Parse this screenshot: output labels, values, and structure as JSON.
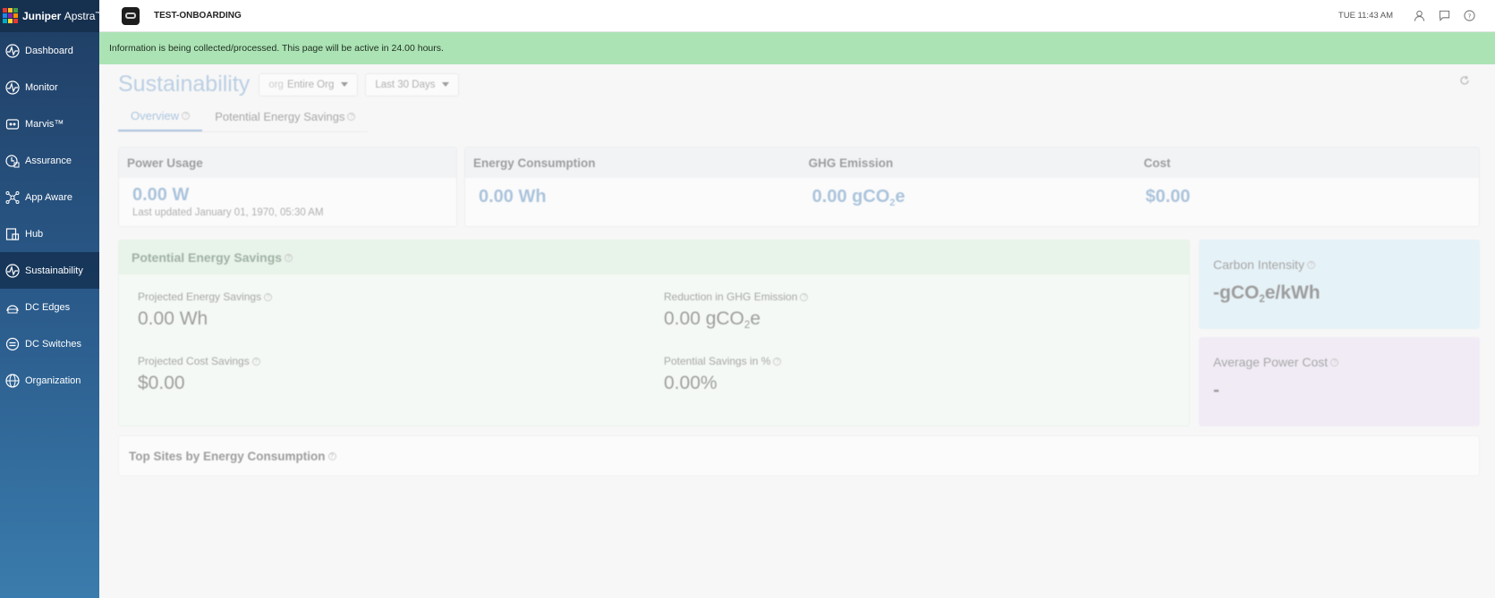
{
  "brand": {
    "name_bold": "Juniper",
    "name_light": "Apstra",
    "trademark": "™",
    "logo_colors": [
      "#e53935",
      "#fbc02d",
      "#43a047",
      "#1e88e5",
      "#8e24aa",
      "#fb8c00",
      "#00acc1",
      "#fdd835",
      "#e53935"
    ]
  },
  "sidebar": {
    "items": [
      {
        "label": "Dashboard",
        "icon": "pulse-icon"
      },
      {
        "label": "Monitor",
        "icon": "pulse-icon"
      },
      {
        "label": "Marvis™",
        "icon": "marvis-icon"
      },
      {
        "label": "Assurance",
        "icon": "assurance-icon"
      },
      {
        "label": "App Aware",
        "icon": "network-icon"
      },
      {
        "label": "Hub",
        "icon": "hub-icon"
      },
      {
        "label": "Sustainability",
        "icon": "pulse-icon",
        "active": true
      },
      {
        "label": "DC Edges",
        "icon": "edge-icon"
      },
      {
        "label": "DC Switches",
        "icon": "switch-icon"
      },
      {
        "label": "Organization",
        "icon": "globe-icon"
      }
    ]
  },
  "topbar": {
    "org_name": "TEST-ONBOARDING",
    "time": "TUE 11:43 AM"
  },
  "banner": {
    "text": "Information is being collected/processed. This page will be active in 24.00 hours."
  },
  "page": {
    "title": "Sustainability",
    "scope_prefix": "org",
    "scope_value": "Entire Org",
    "range_value": "Last 30 Days"
  },
  "tabs": [
    {
      "label": "Overview",
      "active": true
    },
    {
      "label": "Potential Energy Savings",
      "active": false
    }
  ],
  "power_usage": {
    "title": "Power Usage",
    "value": "0.00 W",
    "updated": "Last updated January 01, 1970, 05:30 AM"
  },
  "summary": {
    "energy": {
      "title": "Energy Consumption",
      "value": "0.00 Wh"
    },
    "ghg": {
      "title": "GHG Emission",
      "value_prefix": "0.00 gCO",
      "value_sub": "2",
      "value_suffix": "e"
    },
    "cost": {
      "title": "Cost",
      "value": "$0.00"
    }
  },
  "savings": {
    "title": "Potential Energy Savings",
    "projected_energy": {
      "label": "Projected Energy Savings",
      "value": "0.00 Wh"
    },
    "ghg_reduction": {
      "label": "Reduction in GHG Emission",
      "value_prefix": "0.00 gCO",
      "value_sub": "2",
      "value_suffix": "e"
    },
    "projected_cost": {
      "label": "Projected Cost Savings",
      "value": "$0.00"
    },
    "percent": {
      "label": "Potential Savings in %",
      "value": "0.00%"
    }
  },
  "carbon_intensity": {
    "label": "Carbon Intensity",
    "value_prefix": "-gCO",
    "value_sub": "2",
    "value_suffix": "e/kWh",
    "bg": "#d8eef7"
  },
  "avg_power_cost": {
    "label": "Average Power Cost",
    "value": "-",
    "bg": "#ece3f5"
  },
  "top_sites": {
    "title": "Top Sites by Energy Consumption"
  },
  "help_glyph": "?"
}
